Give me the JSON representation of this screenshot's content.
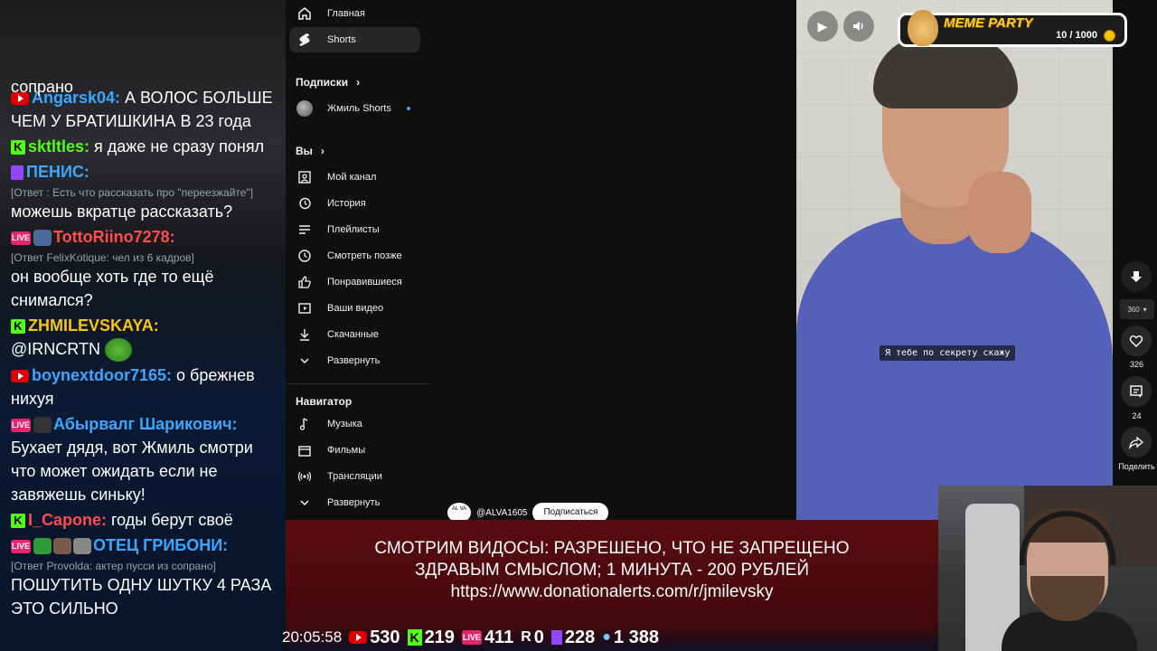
{
  "chat": {
    "top_fragment": "сопрано",
    "messages": [
      {
        "platform": "youtube",
        "user": "Angarsk04:",
        "user_color": "#3ea6ff",
        "text": " А ВОЛОС БОЛЬШЕ ЧЕМ У БРАТИШКИНА В 23 года"
      },
      {
        "platform": "kick",
        "user": "sktltles:",
        "user_color": "#53fc18",
        "text": " я даже не сразу понял"
      },
      {
        "platform": "twitch",
        "user": "ПЕНИС:",
        "user_color": "#3ea6ff",
        "reply": "[Ответ : Есть что рассказать про \"переезжайте\"]",
        "text": "можешь вкратце рассказать?"
      },
      {
        "platform": "live",
        "user": "TottoRiino7278:",
        "user_color": "#ff4d4d",
        "reply": "[Ответ FelixKotique: чел из 6 кадров]",
        "text": "он вообще хоть где то ещё снимался?"
      },
      {
        "platform": "kick",
        "user": "ZHMILEVSKAYA:",
        "user_color": "#f5c518",
        "text": "@IRNCRTN "
      },
      {
        "platform": "youtube",
        "user": "boynextdoor7165:",
        "user_color": "#3ea6ff",
        "text": " о брежнев нихуя"
      },
      {
        "platform": "live",
        "user": "Абырвалг Шарикович:",
        "user_color": "#3ea6ff",
        "text": "Бухает дядя, вот Жмиль смотри что может ожидать если не завяжешь синьку!"
      },
      {
        "platform": "kick",
        "user": "I_Capone:",
        "user_color": "#ff4d4d",
        "text": " годы берут своё"
      },
      {
        "platform": "live",
        "user": "ОТЕЦ ГРИБОНИ:",
        "user_color": "#3ea6ff",
        "reply": "[Ответ Provolda: актер пусси из сопрано]",
        "text": "ПОШУТИТЬ ОДНУ ШУТКУ 4 РАЗА ЭТО СИЛЬНО"
      }
    ]
  },
  "sidebar": {
    "home": "Главная",
    "shorts": "Shorts",
    "subscriptions_header": "Подписки",
    "subscription_channel": "Жмиль Shorts",
    "you_header": "Вы",
    "you_items": [
      "Мой канал",
      "История",
      "Плейлисты",
      "Смотреть позже",
      "Понравившиеся",
      "Ваши видео",
      "Скачанные",
      "Развернуть"
    ],
    "navigator_header": "Навигатор",
    "navigator_items": [
      "Музыка",
      "Фильмы",
      "Трансляции",
      "Развернуть"
    ]
  },
  "short": {
    "caption": "Я тебе по секрету скажу",
    "channel_avatar_text": "AL VA",
    "channel_name": "@ALVA1605",
    "subscribe_label": "Подписаться"
  },
  "actions": {
    "quality": "360",
    "likes": "326",
    "comments": "24",
    "share": "Поделить"
  },
  "meme_party": {
    "title": "MEME PARTY",
    "counter": "10 / 1000"
  },
  "banner": {
    "line1": "СМОТРИМ ВИДОСЫ: РАЗРЕШЕНО, ЧТО НЕ ЗАПРЕЩЕНО",
    "line2": "ЗДРАВЫМ СМЫСЛОМ; 1 МИНУТА - 200 РУБЛЕЙ",
    "line3": "https://www.donationalerts.com/r/jmilevsky"
  },
  "stats": {
    "time": "20:05:58",
    "youtube": "530",
    "kick": "219",
    "live": "411",
    "rutube": "0",
    "twitch": "228",
    "total": "1 388",
    "live_label": "LIVE",
    "k_label": "K",
    "r_label": "R"
  },
  "colors": {
    "banner": "#4a0a0c",
    "accent_blue": "#3ea6ff",
    "kick_green": "#53fc18",
    "live_pink": "#e3266b"
  }
}
